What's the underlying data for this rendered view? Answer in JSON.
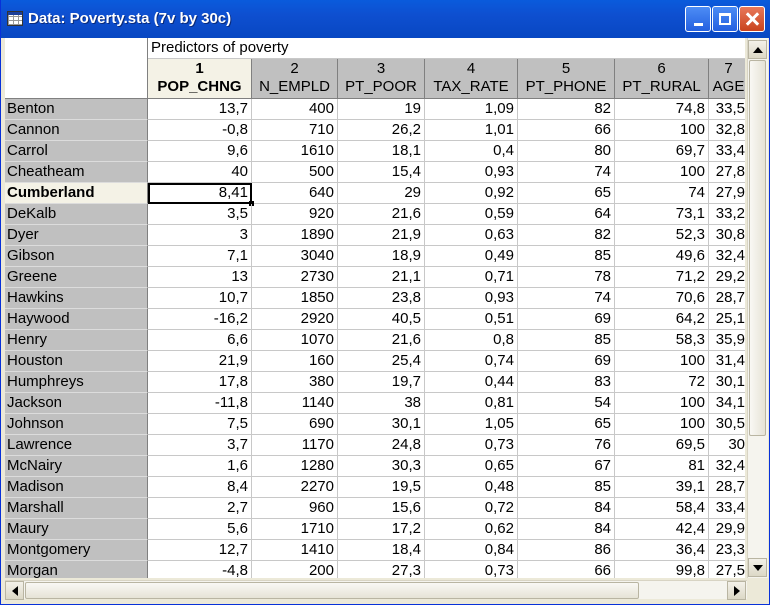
{
  "window": {
    "title": "Data: Poverty.sta (7v by 30c)",
    "icons": {
      "app": "spreadsheet-icon",
      "minimize": "minimize-icon",
      "maximize": "maximize-icon",
      "close": "close-icon"
    }
  },
  "sheet": {
    "group_header": "Predictors of poverty",
    "columns": [
      {
        "num": "1",
        "name": "POP_CHNG"
      },
      {
        "num": "2",
        "name": "N_EMPLD"
      },
      {
        "num": "3",
        "name": "PT_POOR"
      },
      {
        "num": "4",
        "name": "TAX_RATE"
      },
      {
        "num": "5",
        "name": "PT_PHONE"
      },
      {
        "num": "6",
        "name": "PT_RURAL"
      },
      {
        "num": "7",
        "name": "AGE"
      }
    ],
    "active_row": "Cumberland",
    "active_column": "POP_CHNG",
    "rows": [
      {
        "label": "Benton",
        "values": [
          "13,7",
          "400",
          "19",
          "1,09",
          "82",
          "74,8",
          "33,5"
        ]
      },
      {
        "label": "Cannon",
        "values": [
          "-0,8",
          "710",
          "26,2",
          "1,01",
          "66",
          "100",
          "32,8"
        ]
      },
      {
        "label": "Carrol",
        "values": [
          "9,6",
          "1610",
          "18,1",
          "0,4",
          "80",
          "69,7",
          "33,4"
        ]
      },
      {
        "label": "Cheatheam",
        "values": [
          "40",
          "500",
          "15,4",
          "0,93",
          "74",
          "100",
          "27,8"
        ]
      },
      {
        "label": "Cumberland",
        "values": [
          "8,41",
          "640",
          "29",
          "0,92",
          "65",
          "74",
          "27,9"
        ]
      },
      {
        "label": "DeKalb",
        "values": [
          "3,5",
          "920",
          "21,6",
          "0,59",
          "64",
          "73,1",
          "33,2"
        ]
      },
      {
        "label": "Dyer",
        "values": [
          "3",
          "1890",
          "21,9",
          "0,63",
          "82",
          "52,3",
          "30,8"
        ]
      },
      {
        "label": "Gibson",
        "values": [
          "7,1",
          "3040",
          "18,9",
          "0,49",
          "85",
          "49,6",
          "32,4"
        ]
      },
      {
        "label": "Greene",
        "values": [
          "13",
          "2730",
          "21,1",
          "0,71",
          "78",
          "71,2",
          "29,2"
        ]
      },
      {
        "label": "Hawkins",
        "values": [
          "10,7",
          "1850",
          "23,8",
          "0,93",
          "74",
          "70,6",
          "28,7"
        ]
      },
      {
        "label": "Haywood",
        "values": [
          "-16,2",
          "2920",
          "40,5",
          "0,51",
          "69",
          "64,2",
          "25,1"
        ]
      },
      {
        "label": "Henry",
        "values": [
          "6,6",
          "1070",
          "21,6",
          "0,8",
          "85",
          "58,3",
          "35,9"
        ]
      },
      {
        "label": "Houston",
        "values": [
          "21,9",
          "160",
          "25,4",
          "0,74",
          "69",
          "100",
          "31,4"
        ]
      },
      {
        "label": "Humphreys",
        "values": [
          "17,8",
          "380",
          "19,7",
          "0,44",
          "83",
          "72",
          "30,1"
        ]
      },
      {
        "label": "Jackson",
        "values": [
          "-11,8",
          "1140",
          "38",
          "0,81",
          "54",
          "100",
          "34,1"
        ]
      },
      {
        "label": "Johnson",
        "values": [
          "7,5",
          "690",
          "30,1",
          "1,05",
          "65",
          "100",
          "30,5"
        ]
      },
      {
        "label": "Lawrence",
        "values": [
          "3,7",
          "1170",
          "24,8",
          "0,73",
          "76",
          "69,5",
          "30"
        ]
      },
      {
        "label": "McNairy",
        "values": [
          "1,6",
          "1280",
          "30,3",
          "0,65",
          "67",
          "81",
          "32,4"
        ]
      },
      {
        "label": "Madison",
        "values": [
          "8,4",
          "2270",
          "19,5",
          "0,48",
          "85",
          "39,1",
          "28,7"
        ]
      },
      {
        "label": "Marshall",
        "values": [
          "2,7",
          "960",
          "15,6",
          "0,72",
          "84",
          "58,4",
          "33,4"
        ]
      },
      {
        "label": "Maury",
        "values": [
          "5,6",
          "1710",
          "17,2",
          "0,62",
          "84",
          "42,4",
          "29,9"
        ]
      },
      {
        "label": "Montgomery",
        "values": [
          "12,7",
          "1410",
          "18,4",
          "0,84",
          "86",
          "36,4",
          "23,3"
        ]
      },
      {
        "label": "Morgan",
        "values": [
          "-4,8",
          "200",
          "27,3",
          "0,73",
          "66",
          "99,8",
          "27,5"
        ]
      }
    ]
  },
  "scrollbars": {
    "icons": {
      "up": "arrow-up-icon",
      "down": "arrow-down-icon",
      "left": "arrow-left-icon",
      "right": "arrow-right-icon"
    }
  }
}
